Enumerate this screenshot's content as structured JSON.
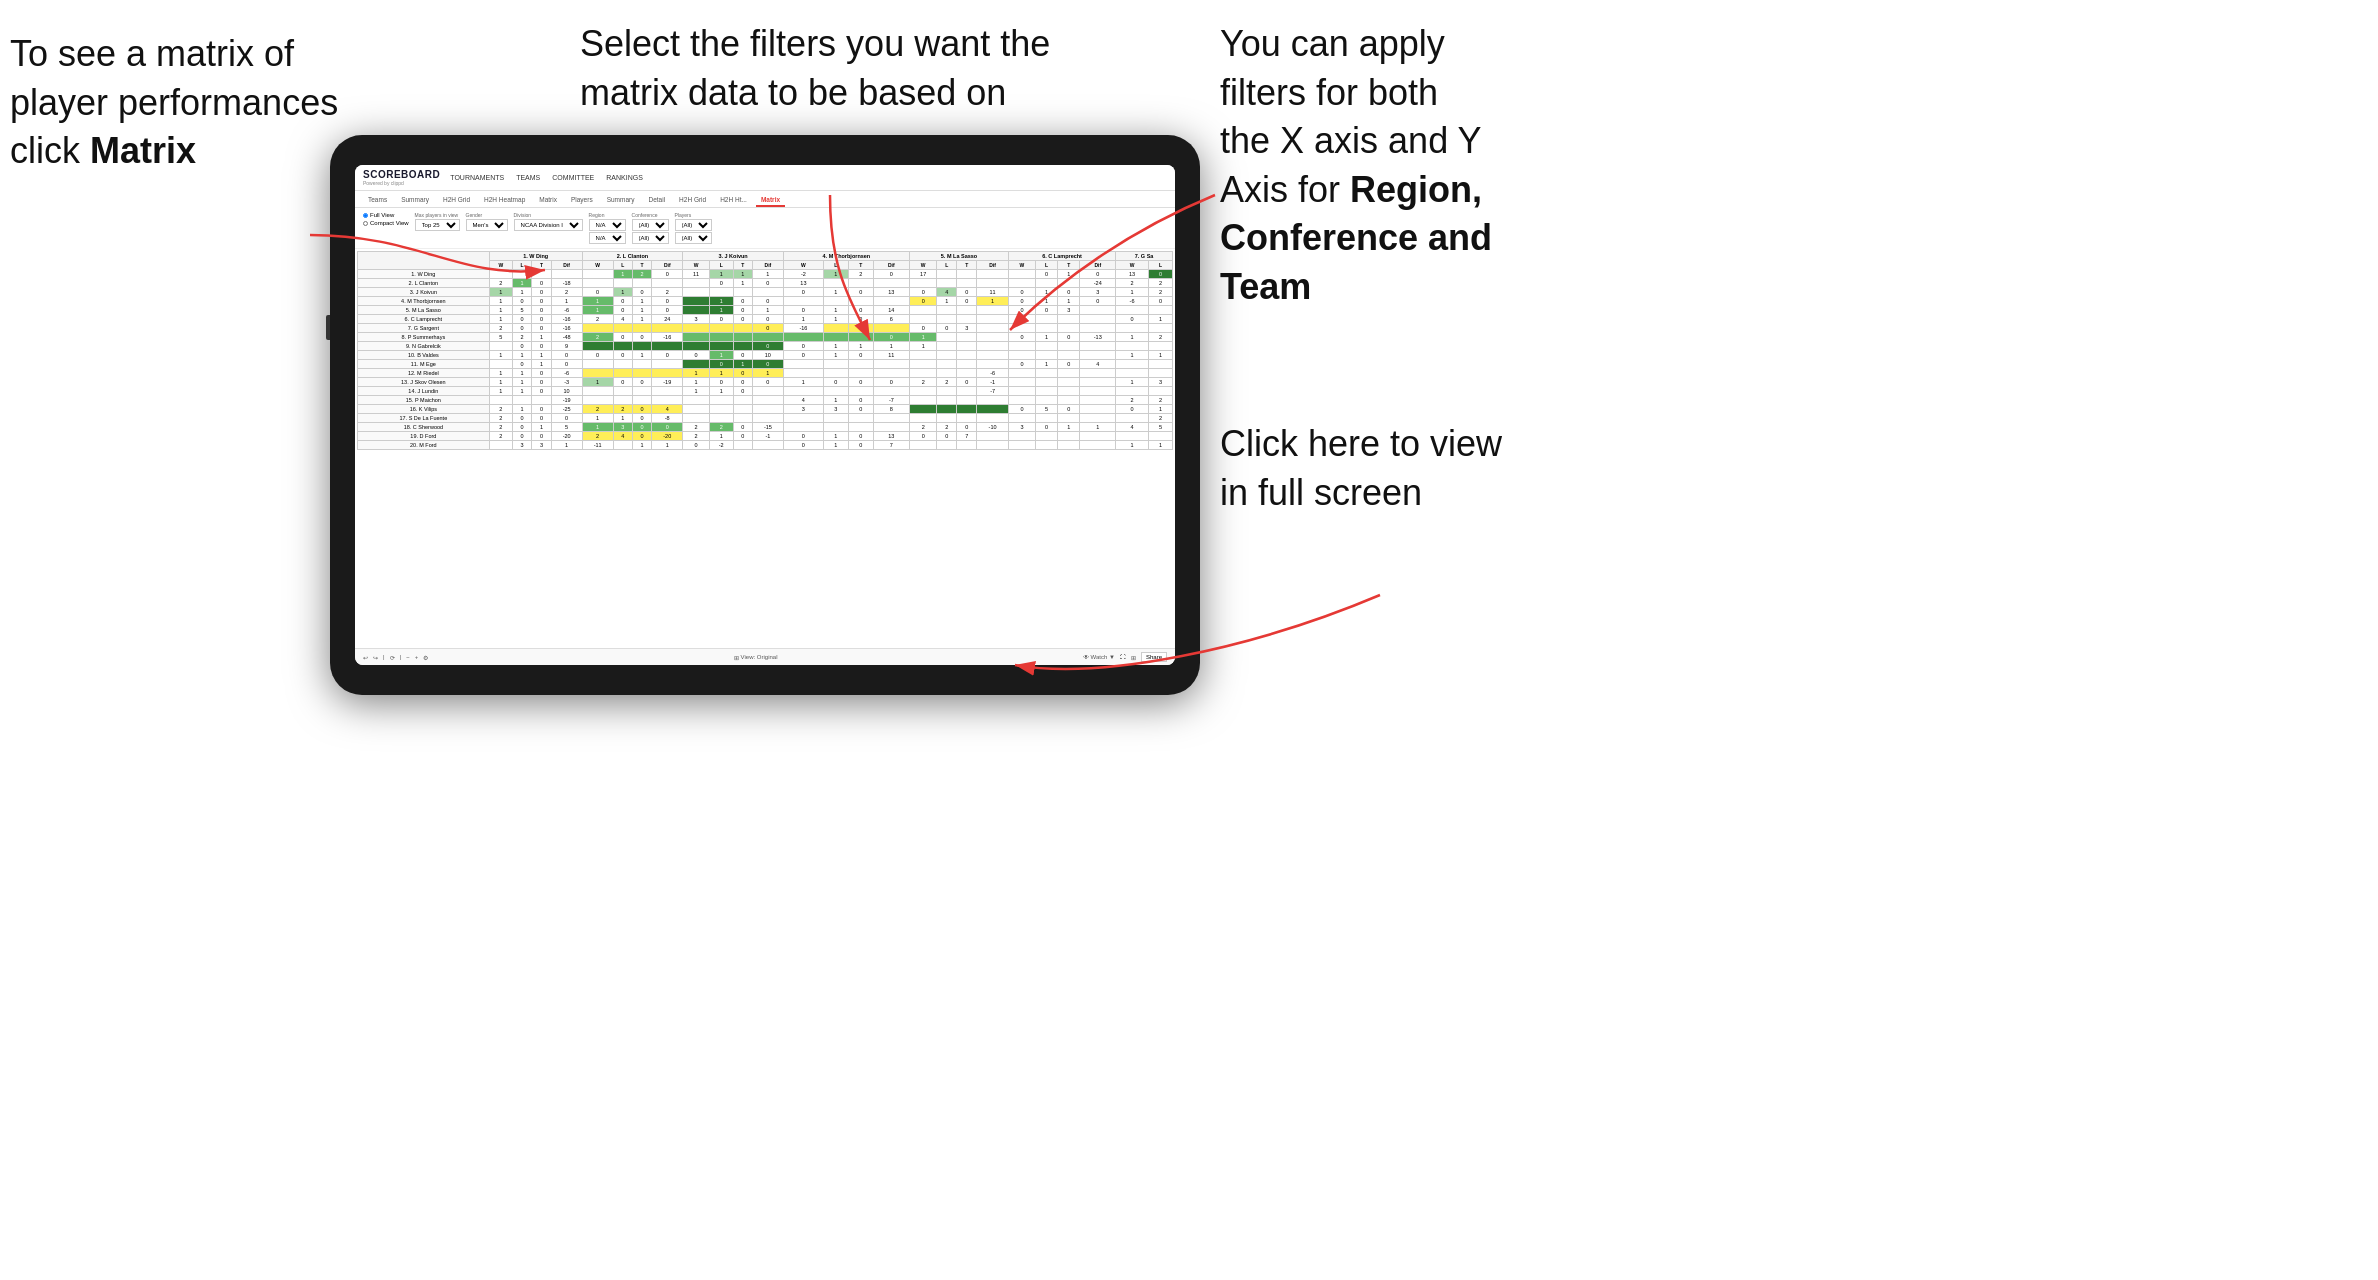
{
  "annotations": {
    "topleft": {
      "line1": "To see a matrix of",
      "line2": "player performances",
      "line3_plain": "click ",
      "line3_bold": "Matrix"
    },
    "topmid": {
      "line1": "Select the filters you want the",
      "line2": "matrix data to be based on"
    },
    "topright": {
      "line1": "You  can apply",
      "line2": "filters for both",
      "line3": "the X axis and Y",
      "line4_plain": "Axis for ",
      "line4_bold": "Region,",
      "line5_bold": "Conference and",
      "line6_bold": "Team"
    },
    "bottomright": {
      "line1": "Click here to view",
      "line2": "in full screen"
    }
  },
  "app": {
    "logo": "SCOREBOARD",
    "logo_sub": "Powered by clippd",
    "nav": [
      "TOURNAMENTS",
      "TEAMS",
      "COMMITTEE",
      "RANKINGS"
    ]
  },
  "tabs": {
    "players_subtabs": [
      "Teams",
      "Summary",
      "H2H Grid",
      "H2H Heatmap",
      "Matrix",
      "Players",
      "Summary",
      "Detail",
      "H2H Grid",
      "H2H Ht...",
      "Matrix"
    ],
    "active": "Matrix"
  },
  "filters": {
    "view_full": "Full View",
    "view_compact": "Compact View",
    "max_players_label": "Max players in view",
    "max_players_value": "Top 25",
    "gender_label": "Gender",
    "gender_value": "Men's",
    "division_label": "Division",
    "division_value": "NCAA Division I",
    "region_label": "Region",
    "region_values": [
      "N/A",
      "N/A"
    ],
    "conference_label": "Conference",
    "conference_values": [
      "(All)",
      "(All)"
    ],
    "players_label": "Players",
    "players_values": [
      "(All)",
      "(All)"
    ]
  },
  "matrix": {
    "col_headers": [
      "1. W Ding",
      "2. L Clanton",
      "3. J Koivun",
      "4. M Thorbjornsen",
      "5. M La Sasso",
      "6. C Lamprecht",
      "7. G Sa"
    ],
    "col_sub": [
      "W",
      "L",
      "T",
      "Dif"
    ],
    "rows": [
      {
        "name": "1. W Ding"
      },
      {
        "name": "2. L Clanton"
      },
      {
        "name": "3. J Koivun"
      },
      {
        "name": "4. M Thorbjornsen"
      },
      {
        "name": "5. M La Sasso"
      },
      {
        "name": "6. C Lamprecht"
      },
      {
        "name": "7. G Sargent"
      },
      {
        "name": "8. P Summerhays"
      },
      {
        "name": "9. N Gabrelcik"
      },
      {
        "name": "10. B Valdes"
      },
      {
        "name": "11. M Ege"
      },
      {
        "name": "12. M Riedel"
      },
      {
        "name": "13. J Skov Olesen"
      },
      {
        "name": "14. J Lundin"
      },
      {
        "name": "15. P Maichon"
      },
      {
        "name": "16. K Vilips"
      },
      {
        "name": "17. S De La Fuente"
      },
      {
        "name": "18. C Sherwood"
      },
      {
        "name": "19. D Ford"
      },
      {
        "name": "20. M Ford"
      }
    ]
  },
  "toolbar": {
    "view_label": "View: Original",
    "watch_label": "Watch",
    "share_label": "Share"
  }
}
